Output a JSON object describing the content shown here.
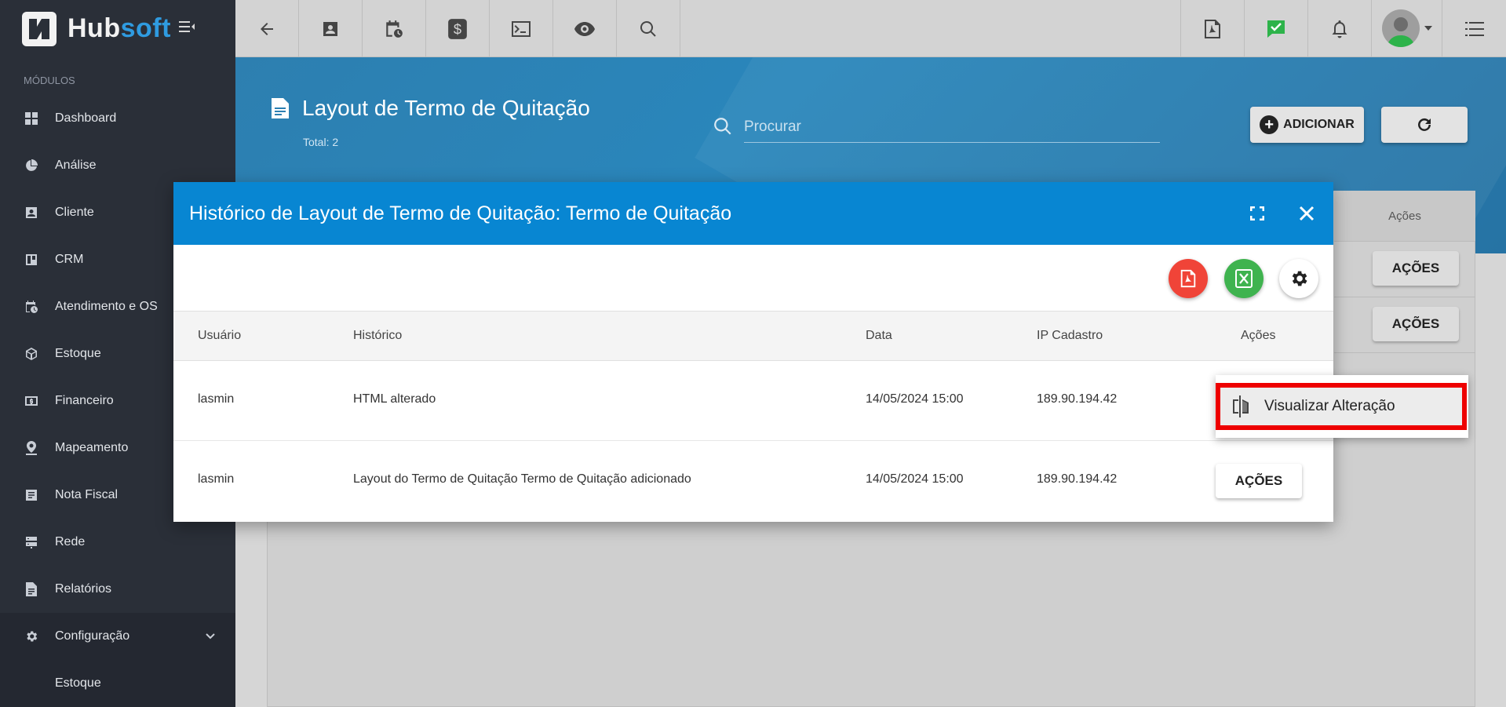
{
  "brand": {
    "name_part1": "Hub",
    "name_part2": "soft"
  },
  "sidebar": {
    "section_label": "MÓDULOS",
    "items": [
      {
        "label": "Dashboard",
        "icon": "dashboard-icon"
      },
      {
        "label": "Análise",
        "icon": "pie-chart-icon"
      },
      {
        "label": "Cliente",
        "icon": "contact-card-icon"
      },
      {
        "label": "CRM",
        "icon": "board-icon"
      },
      {
        "label": "Atendimento e OS",
        "icon": "calendar-clock-icon"
      },
      {
        "label": "Estoque",
        "icon": "box-icon"
      },
      {
        "label": "Financeiro",
        "icon": "money-icon"
      },
      {
        "label": "Mapeamento",
        "icon": "map-pin-icon"
      },
      {
        "label": "Nota Fiscal",
        "icon": "invoice-icon"
      },
      {
        "label": "Rede",
        "icon": "server-icon"
      },
      {
        "label": "Relatórios",
        "icon": "report-icon"
      },
      {
        "label": "Configuração",
        "icon": "gear-icon"
      }
    ],
    "sub_item": "Estoque"
  },
  "page": {
    "title": "Layout de Termo de Quitação",
    "total": "Total: 2",
    "search_placeholder": "Procurar",
    "add_label": "ADICIONAR"
  },
  "background_table": {
    "header": "Ações",
    "action_label": "AÇÕES"
  },
  "modal": {
    "title": "Histórico de Layout de Termo de Quitação: Termo de Quitação",
    "columns": [
      "Usuário",
      "Histórico",
      "Data",
      "IP Cadastro",
      "Ações"
    ],
    "rows": [
      {
        "user": "lasmin",
        "history": "HTML alterado",
        "date": "14/05/2024 15:00",
        "ip": "189.90.194.42"
      },
      {
        "user": "lasmin",
        "history": "Layout do Termo de Quitação Termo de Quitação adicionado",
        "date": "14/05/2024 15:00",
        "ip": "189.90.194.42",
        "action_label": "AÇÕES"
      }
    ]
  },
  "dropdown": {
    "item_label": "Visualizar Alteração"
  },
  "colors": {
    "modal_header": "#0886d2",
    "sidebar": "#2a2f38",
    "highlight": "#ee0000",
    "pdf": "#f04438",
    "excel": "#3fb34f"
  }
}
